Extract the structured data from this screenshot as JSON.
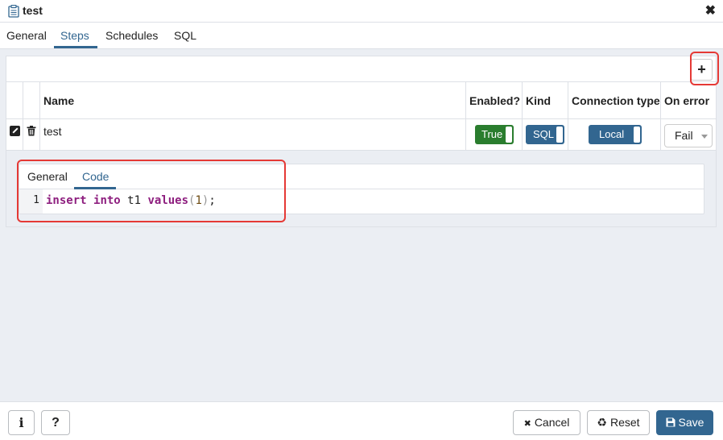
{
  "window": {
    "title": "test",
    "close_glyph": "✖"
  },
  "tabs": [
    {
      "label": "General"
    },
    {
      "label": "Steps"
    },
    {
      "label": "Schedules"
    },
    {
      "label": "SQL"
    }
  ],
  "active_tab": "Steps",
  "grid": {
    "add_glyph": "+",
    "columns": [
      "Name",
      "Enabled?",
      "Kind",
      "Connection type",
      "On error"
    ],
    "rows": [
      {
        "name": "test",
        "enabled": "True",
        "kind": "SQL",
        "connection_type": "Local",
        "on_error": "Fail"
      }
    ]
  },
  "detail": {
    "tabs": [
      {
        "label": "General"
      },
      {
        "label": "Code"
      }
    ],
    "active_tab": "Code",
    "code": {
      "line_number": "1",
      "tokens": {
        "kw1": "insert",
        "kw2": "into",
        "ident": "t1",
        "kw3": "values",
        "lparen": "(",
        "num": "1",
        "rparen": ")",
        "semi": ";"
      }
    }
  },
  "footer": {
    "info_glyph": "i",
    "help_glyph": "?",
    "cancel_label": "Cancel",
    "cancel_glyph": "✖",
    "reset_label": "Reset",
    "reset_glyph": "♻",
    "save_label": "Save"
  },
  "colors": {
    "accent": "#326690",
    "enabled_true": "#2a7d2e",
    "kind_sql": "#326690",
    "highlight": "#e53935"
  }
}
